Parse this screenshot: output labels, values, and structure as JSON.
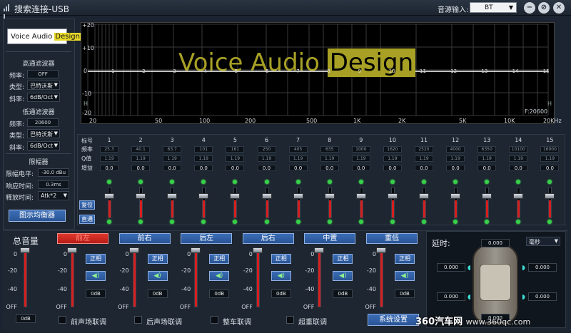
{
  "titlebar": {
    "title": "搜索连接-USB",
    "source_label": "音源输入:",
    "source_value": "BT",
    "min_icon": "minimize-icon",
    "restore_icon": "settings-icon",
    "close_icon": "close-icon"
  },
  "left": {
    "logo_text_a": "Voice Audio ",
    "logo_text_b": "Design",
    "hp_title": "高通滤波器",
    "hp_freq_label": "频率:",
    "hp_freq": "OFF",
    "hp_type_label": "类型:",
    "hp_type": "巴特沃斯",
    "hp_slope_label": "斜率:",
    "hp_slope": "6dB/Oct",
    "lp_title": "低通滤波器",
    "lp_freq_label": "频率:",
    "lp_freq": "20600",
    "lp_type_label": "类型:",
    "lp_type": "巴特沃斯",
    "lp_slope_label": "斜率:",
    "lp_slope": "6dB/Oct",
    "lim_title": "限幅器",
    "lim_level_label": "限幅电平:",
    "lim_level": "-30.0 dBu",
    "lim_resp_label": "响应时间:",
    "lim_resp": "0.3ms",
    "lim_rel_label": "释放时间:",
    "lim_rel": "Atk*2",
    "geq_button": "图示均衡器"
  },
  "graph": {
    "y_ticks": [
      "+20",
      "+10",
      "0",
      "-10",
      "-20"
    ],
    "x_ticks": [
      "20",
      "50",
      "100",
      "200",
      "500",
      "1K",
      "2K",
      "5K",
      "10K",
      "20KHz"
    ],
    "watermark_a": "Voice Audio ",
    "watermark_b": "Design",
    "freq_readout": "F:20600",
    "h_marks": [
      "H",
      "H"
    ],
    "point_labels": [
      "1",
      "2",
      "3",
      "4",
      "5",
      "6",
      "7",
      "8",
      "9",
      "10",
      "11",
      "12",
      "13",
      "14",
      "15"
    ]
  },
  "bands": {
    "row_labels": [
      "标号",
      "频率",
      "Q值",
      "增益"
    ],
    "reset_button": "复位",
    "bypass_button": "直通",
    "items": [
      {
        "n": "1",
        "f": "25.3",
        "q": "1.19",
        "g": "0.0"
      },
      {
        "n": "2",
        "f": "40.1",
        "q": "1.19",
        "g": "0.0"
      },
      {
        "n": "3",
        "f": "63.7",
        "q": "1.19",
        "g": "0.0"
      },
      {
        "n": "4",
        "f": "101",
        "q": "1.19",
        "g": "0.0"
      },
      {
        "n": "5",
        "f": "161",
        "q": "1.19",
        "g": "0.0"
      },
      {
        "n": "6",
        "f": "250",
        "q": "1.19",
        "g": "0.0"
      },
      {
        "n": "7",
        "f": "405",
        "q": "1.19",
        "g": "0.0"
      },
      {
        "n": "8",
        "f": "635",
        "q": "1.19",
        "g": "0.0"
      },
      {
        "n": "9",
        "f": "1000",
        "q": "1.19",
        "g": "0.0"
      },
      {
        "n": "10",
        "f": "1620",
        "q": "1.19",
        "g": "0.0"
      },
      {
        "n": "11",
        "f": "2520",
        "q": "1.19",
        "g": "0.0"
      },
      {
        "n": "12",
        "f": "4000",
        "q": "1.19",
        "g": "0.0"
      },
      {
        "n": "13",
        "f": "6350",
        "q": "1.19",
        "g": "0.0"
      },
      {
        "n": "14",
        "f": "10100",
        "q": "1.19",
        "g": "0.0"
      },
      {
        "n": "15",
        "f": "16000",
        "q": "1.19",
        "g": "0.0"
      }
    ]
  },
  "master": {
    "title": "总音量",
    "value": "0dB",
    "scale": [
      "0",
      "-20",
      "-40",
      "OFF"
    ]
  },
  "channels": [
    {
      "name": "前左",
      "phase": "正相",
      "value": "0dB"
    },
    {
      "name": "前右",
      "phase": "正相",
      "value": "0dB"
    },
    {
      "name": "后左",
      "phase": "正相",
      "value": "0dB"
    },
    {
      "name": "后右",
      "phase": "正相",
      "value": "0dB"
    },
    {
      "name": "中置",
      "phase": "正相",
      "value": "0dB"
    },
    {
      "name": "重低",
      "phase": "正相",
      "value": "0dB"
    }
  ],
  "channel_scale": [
    "0",
    "-20",
    "-40",
    "OFF"
  ],
  "links": [
    "前声场联调",
    "后声场联调",
    "整车联调",
    "超重联调"
  ],
  "system_settings": "系统设置",
  "delay": {
    "title": "延时:",
    "unit": "毫秒",
    "values": [
      "0.000",
      "0.000",
      "0.000",
      "0.000",
      "0.000",
      "0.000"
    ]
  },
  "watermark": {
    "brand": "360汽车网",
    "url": "www.360qc.com"
  },
  "colors": {
    "accent_blue": "#2a5596",
    "slider_red": "#d81e1e",
    "led_green": "#36d04a",
    "logo_yellow": "#e8d92a"
  }
}
